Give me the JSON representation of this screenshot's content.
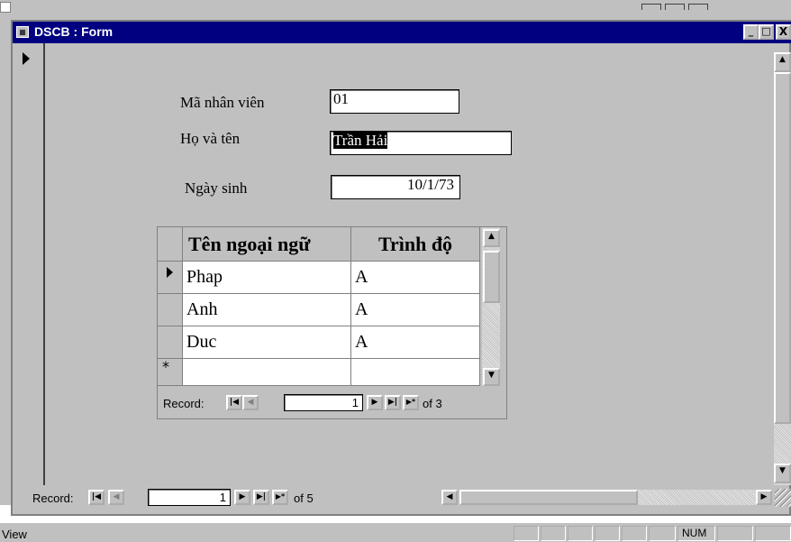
{
  "window": {
    "title": "DSCB : Form",
    "minimize": "_",
    "maximize": "□",
    "close": "X"
  },
  "fields": {
    "employee_id_label": "Mã nhân viên",
    "employee_id_value": "01",
    "full_name_label": "Họ và tên",
    "full_name_value": "Trần Hải",
    "birth_date_label": "Ngày sinh",
    "birth_date_value": "10/1/73"
  },
  "subform": {
    "columns": [
      "Tên ngoại ngữ",
      "Trình độ"
    ],
    "rows": [
      {
        "language": "Phap",
        "level": "A"
      },
      {
        "language": "Anh",
        "level": "A"
      },
      {
        "language": "Duc",
        "level": "A"
      }
    ],
    "new_row_marker": "*",
    "nav": {
      "label": "Record:",
      "current": "1",
      "of_text": "of 3"
    }
  },
  "main_nav": {
    "label": "Record:",
    "current": "1",
    "of_text": "of 5"
  },
  "statusbar": {
    "left_text": "View",
    "num_indicator": "NUM"
  },
  "colors": {
    "titlebar": "#000080",
    "face": "#c0c0c0",
    "field_bg": "#ffffff",
    "highlight": "#000000"
  }
}
